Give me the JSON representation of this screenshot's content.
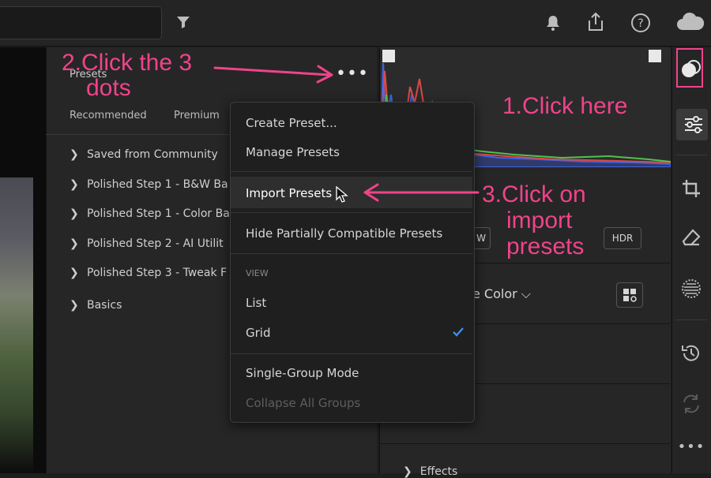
{
  "toolbar": {
    "icons": [
      "filter-icon",
      "bell-icon",
      "share-icon",
      "help-icon",
      "cloud-icon"
    ]
  },
  "presets_panel": {
    "title": "Presets",
    "tabs": [
      "Recommended",
      "Premium"
    ],
    "groups": [
      "Saved from Community",
      "Polished Step 1 - B&W Ba",
      "Polished Step 1 - Color Ba",
      "Polished Step 2 - AI Utilit",
      "Polished Step 3 - Tweak F",
      "Basics"
    ]
  },
  "menu": {
    "create": "Create Preset...",
    "manage": "Manage Presets",
    "import": "Import Presets",
    "hide": "Hide Partially Compatible Presets",
    "view_header": "VIEW",
    "list": "List",
    "grid": "Grid",
    "single_group": "Single-Group Mode",
    "collapse": "Collapse All Groups"
  },
  "edit_panel": {
    "w_fragment": "W",
    "hdr": "HDR",
    "profile_fragment": "e Color",
    "effects_fragment": "Effects"
  },
  "annotations": {
    "step1": "1.Click here",
    "step2_line1": "2.Click the 3",
    "step2_line2": "dots",
    "step3_line1": "3.Click on",
    "step3_line2": "import",
    "step3_line3": "presets"
  },
  "colors": {
    "annotation": "#f0438a",
    "accent_check": "#3b8eea"
  }
}
